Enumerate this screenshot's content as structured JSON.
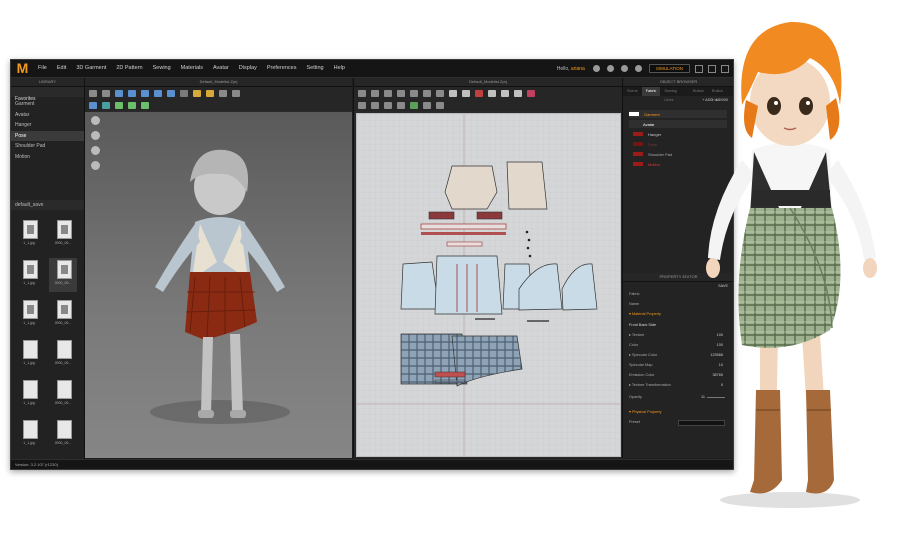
{
  "app": {
    "logo": "M",
    "menu": [
      "File",
      "Edit",
      "3D Garment",
      "2D Pattern",
      "Sewing",
      "Materials",
      "Avatar",
      "Display",
      "Preferences",
      "Setting",
      "Help"
    ],
    "user_label": "Hello,",
    "user_name": "ariana",
    "simulation_label": "SIMULATION",
    "version": "Version: 3.2.107 (r1230)"
  },
  "library": {
    "title": "LIBRARY",
    "tab": "Favorites",
    "items": [
      "Garment",
      "Avatar",
      "Hanger",
      "Pose",
      "Shoulder Pad",
      "Motion"
    ],
    "selected_index": 3,
    "folder": "default_save",
    "thumbs": [
      "1_1.jpg",
      "0000_00...",
      "1_1.jpg",
      "0000_00...",
      "1_1.jpg",
      "0000_00...",
      "1_1.jpg",
      "0000_00...",
      "1_1.jpg",
      "0000_00...",
      "1_1.jpg",
      "0000_00..."
    ]
  },
  "view3d": {
    "title": "Default_Modelist.Zprj"
  },
  "view2d": {
    "title": "Default_Modelist.Zprj"
  },
  "object_browser": {
    "title": "OBJECT BROWSER",
    "tabs": [
      "Scene",
      "Fabric",
      "Sewing Lines",
      "Button",
      "Button Hole"
    ],
    "active_tab": 1,
    "add_label": "+ ADD",
    "count_label": "4/2/000",
    "items": [
      {
        "label": "Garment",
        "color": "#ffffff",
        "text_color": "#f39a1e",
        "bar": true
      },
      {
        "label": "Avatar",
        "color": "",
        "text_color": "#ffffff",
        "bar": true
      },
      {
        "label": "Hanger",
        "color": "#9b1b1b",
        "text_color": "#cccccc",
        "bar": false
      },
      {
        "label": "Pose",
        "color": "#6f1717",
        "text_color": "#7a3a3a",
        "bar": false
      },
      {
        "label": "Shoulder Pad",
        "color": "#9b1b1b",
        "text_color": "#aaaaaa",
        "bar": false
      },
      {
        "label": "Motion",
        "color": "#9b1b1b",
        "text_color": "#d93a3a",
        "bar": false
      }
    ]
  },
  "property_editor": {
    "title": "PROPERTY EDITOR",
    "save_label": "SAVE",
    "rows": [
      {
        "label": "Fabric",
        "value": ""
      },
      {
        "label": "Name",
        "value": ""
      },
      {
        "label": "Material Property",
        "value": "",
        "section": true
      },
      {
        "label": "Front    Back    Side",
        "value": ""
      },
      {
        "label": "Texture",
        "value": "100"
      },
      {
        "label": "Color",
        "value": "100"
      },
      {
        "label": "Specular Color",
        "value": "123566"
      },
      {
        "label": "Specular Map",
        "value": "10"
      },
      {
        "label": "Emission Color",
        "value": "38765"
      },
      {
        "label": "Texture Transformation",
        "value": "0"
      },
      {
        "label": "Opacity",
        "value": "11"
      },
      {
        "label": "Physical Property",
        "value": "",
        "section": true
      },
      {
        "label": "Preset",
        "value": ""
      }
    ]
  },
  "colors": {
    "accent": "#f39a1e",
    "bg": "#1e1e1e",
    "panel": "#232323"
  }
}
